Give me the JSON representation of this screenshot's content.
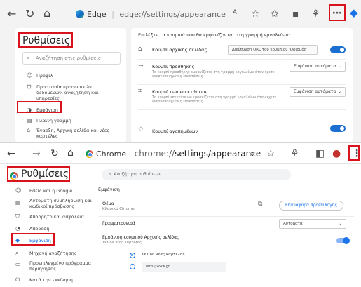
{
  "edge": {
    "url_label": "Edge",
    "url_path": "edge://settings/appearance",
    "settings_title": "Ρυθμίσεις",
    "search_placeholder": "Αναζήτηση στις ρυθμίσεις",
    "sidebar": [
      "Προφίλ",
      "Προστασία προσωπικών δεδομένων, αναζήτηση και υπηρεσίες",
      "Εμφάνιση",
      "Πλαϊνή γραμμή",
      "Έναρξη, Αρχική σελίδα και νέες καρτέλες"
    ],
    "main": {
      "heading": "Επιλέξτε τα κουμπιά που θα εμφανίζονται στη γραμμή εργαλείων:",
      "rows": [
        {
          "title": "Κουμπί αρχικής σελίδας",
          "value": "Διεύθυνση URL του κουμπιού 'Ορισμός'"
        },
        {
          "title": "Κουμπί προσθήκης",
          "value": "Εμφάνιση αυτόματα",
          "desc": "Το κουμπί προσθήκης εμφανίζεται στη γραμμή εργαλείων όταν έχετε ενεργοποιημένες επεκτάσεις"
        },
        {
          "title": "Κουμπί των επεκτάσεων",
          "value": "Εμφάνιση αυτόματα",
          "desc": "Το κουμπί επεκτάσεων εμφανίζεται στη γραμμή εργαλείων όταν έχετε ενεργοποιημένες επεκτάσεις"
        },
        {
          "title": "Κουμπί αγαπημένων"
        }
      ]
    }
  },
  "chrome": {
    "url_label": "Chrome",
    "url_host": "chrome://",
    "url_path": "settings/appearance",
    "settings_title": "Ρυθμίσεις",
    "search_placeholder": "Αναζήτηση ρυθμίσεων",
    "sidebar": [
      "Εσείς και η Google",
      "Αυτόματη συμπλήρωση και κωδικοί πρόσβασης",
      "Απόρρητο και ασφάλεια",
      "Απόδοση",
      "Εμφάνιση",
      "Μηχανή αναζήτησης",
      "Προεπιλεγμένο πρόγραμμα περιήγησης",
      "Κατά την εκκίνηση"
    ],
    "main": {
      "section_title": "Εμφάνιση",
      "theme_label": "Θέμα",
      "theme_value": "Κλασικό Chrome",
      "reset_button": "Επαναφορά προεπιλογής",
      "toolbar_label": "Γραμματοσειρά",
      "toolbar_value": "Αυτόματα",
      "home_label": "Εμφάνιση κουμπιού Αρχικής σελίδας",
      "home_sub": "Σελίδα νέας καρτέλας",
      "radio_1": "Σελίδα νέας καρτέλας",
      "radio_2": "http://www.gr"
    }
  }
}
